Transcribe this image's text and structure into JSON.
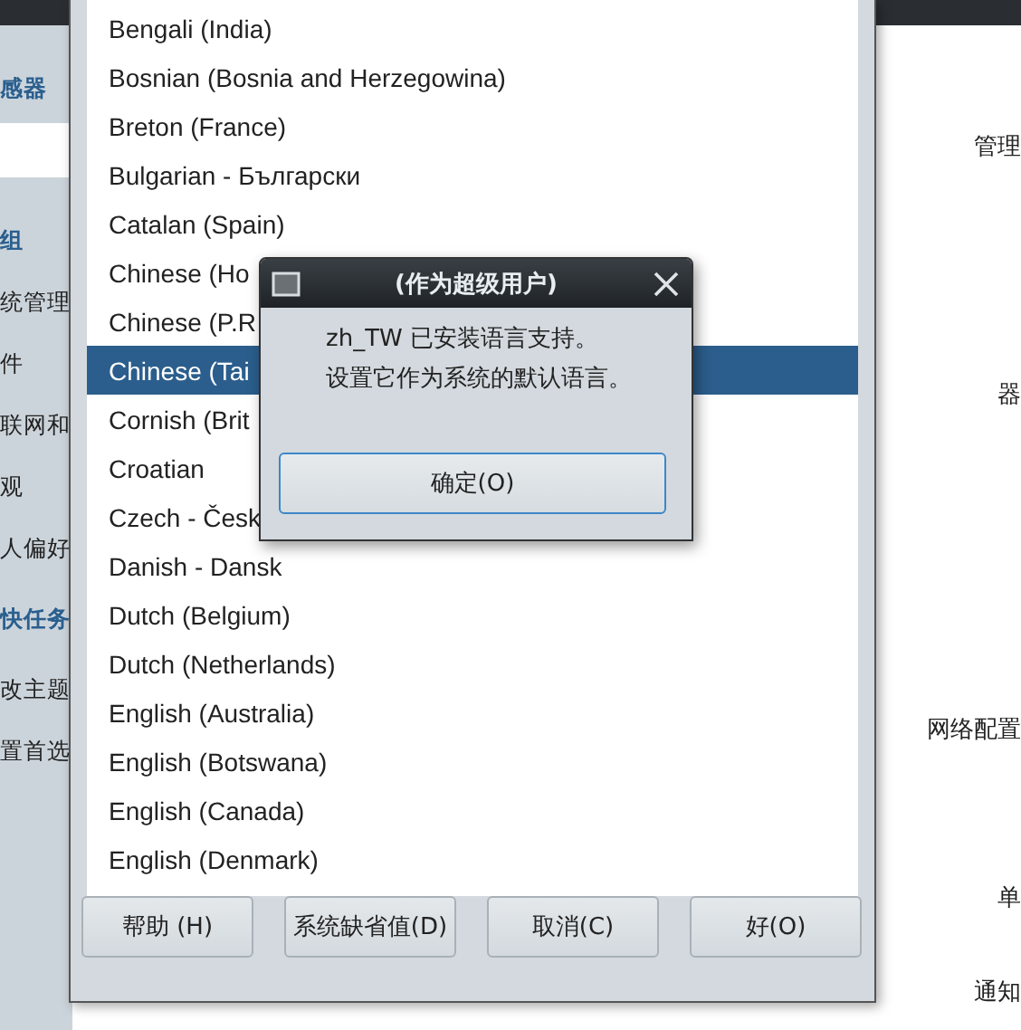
{
  "background_window": {
    "sidebar": {
      "heading": "感器",
      "items": [
        {
          "kind": "heading",
          "label": "组"
        },
        {
          "kind": "item",
          "label": "统管理"
        },
        {
          "kind": "item",
          "label": "件"
        },
        {
          "kind": "item",
          "label": "联网和"
        },
        {
          "kind": "item",
          "label": "观"
        },
        {
          "kind": "item",
          "label": "人偏好"
        },
        {
          "kind": "heading",
          "label": "快任务"
        },
        {
          "kind": "item",
          "label": "改主题"
        },
        {
          "kind": "item",
          "label": "置首选"
        }
      ]
    },
    "content_items": [
      "管理",
      "器",
      "网络配置",
      "单",
      "通知"
    ]
  },
  "language_window": {
    "languages": [
      {
        "label": "Bengali (India)",
        "selected": false
      },
      {
        "label": "Bosnian (Bosnia and Herzegowina)",
        "selected": false
      },
      {
        "label": "Breton (France)",
        "selected": false
      },
      {
        "label": "Bulgarian - Български",
        "selected": false
      },
      {
        "label": "Catalan (Spain)",
        "selected": false
      },
      {
        "label": "Chinese (Ho",
        "selected": false
      },
      {
        "label": "Chinese (P.R",
        "selected": false
      },
      {
        "label": "Chinese (Tai",
        "selected": true
      },
      {
        "label": "Cornish (Brit",
        "selected": false
      },
      {
        "label": "Croatian",
        "selected": false
      },
      {
        "label": "Czech - Česk",
        "selected": false
      },
      {
        "label": "Danish - Dansk",
        "selected": false
      },
      {
        "label": "Dutch (Belgium)",
        "selected": false
      },
      {
        "label": "Dutch (Netherlands)",
        "selected": false
      },
      {
        "label": "English (Australia)",
        "selected": false
      },
      {
        "label": "English (Botswana)",
        "selected": false
      },
      {
        "label": "English (Canada)",
        "selected": false
      },
      {
        "label": "English (Denmark)",
        "selected": false
      }
    ],
    "buttons": [
      "帮助 (H)",
      "系统缺省值(D)",
      "取消(C)",
      "好(O)"
    ]
  },
  "message_dialog": {
    "title": "(作为超级用户)",
    "lines": [
      "zh_TW 已安装语言支持。",
      "设置它作为系统的默认语言。"
    ],
    "button": "确定(O)"
  }
}
